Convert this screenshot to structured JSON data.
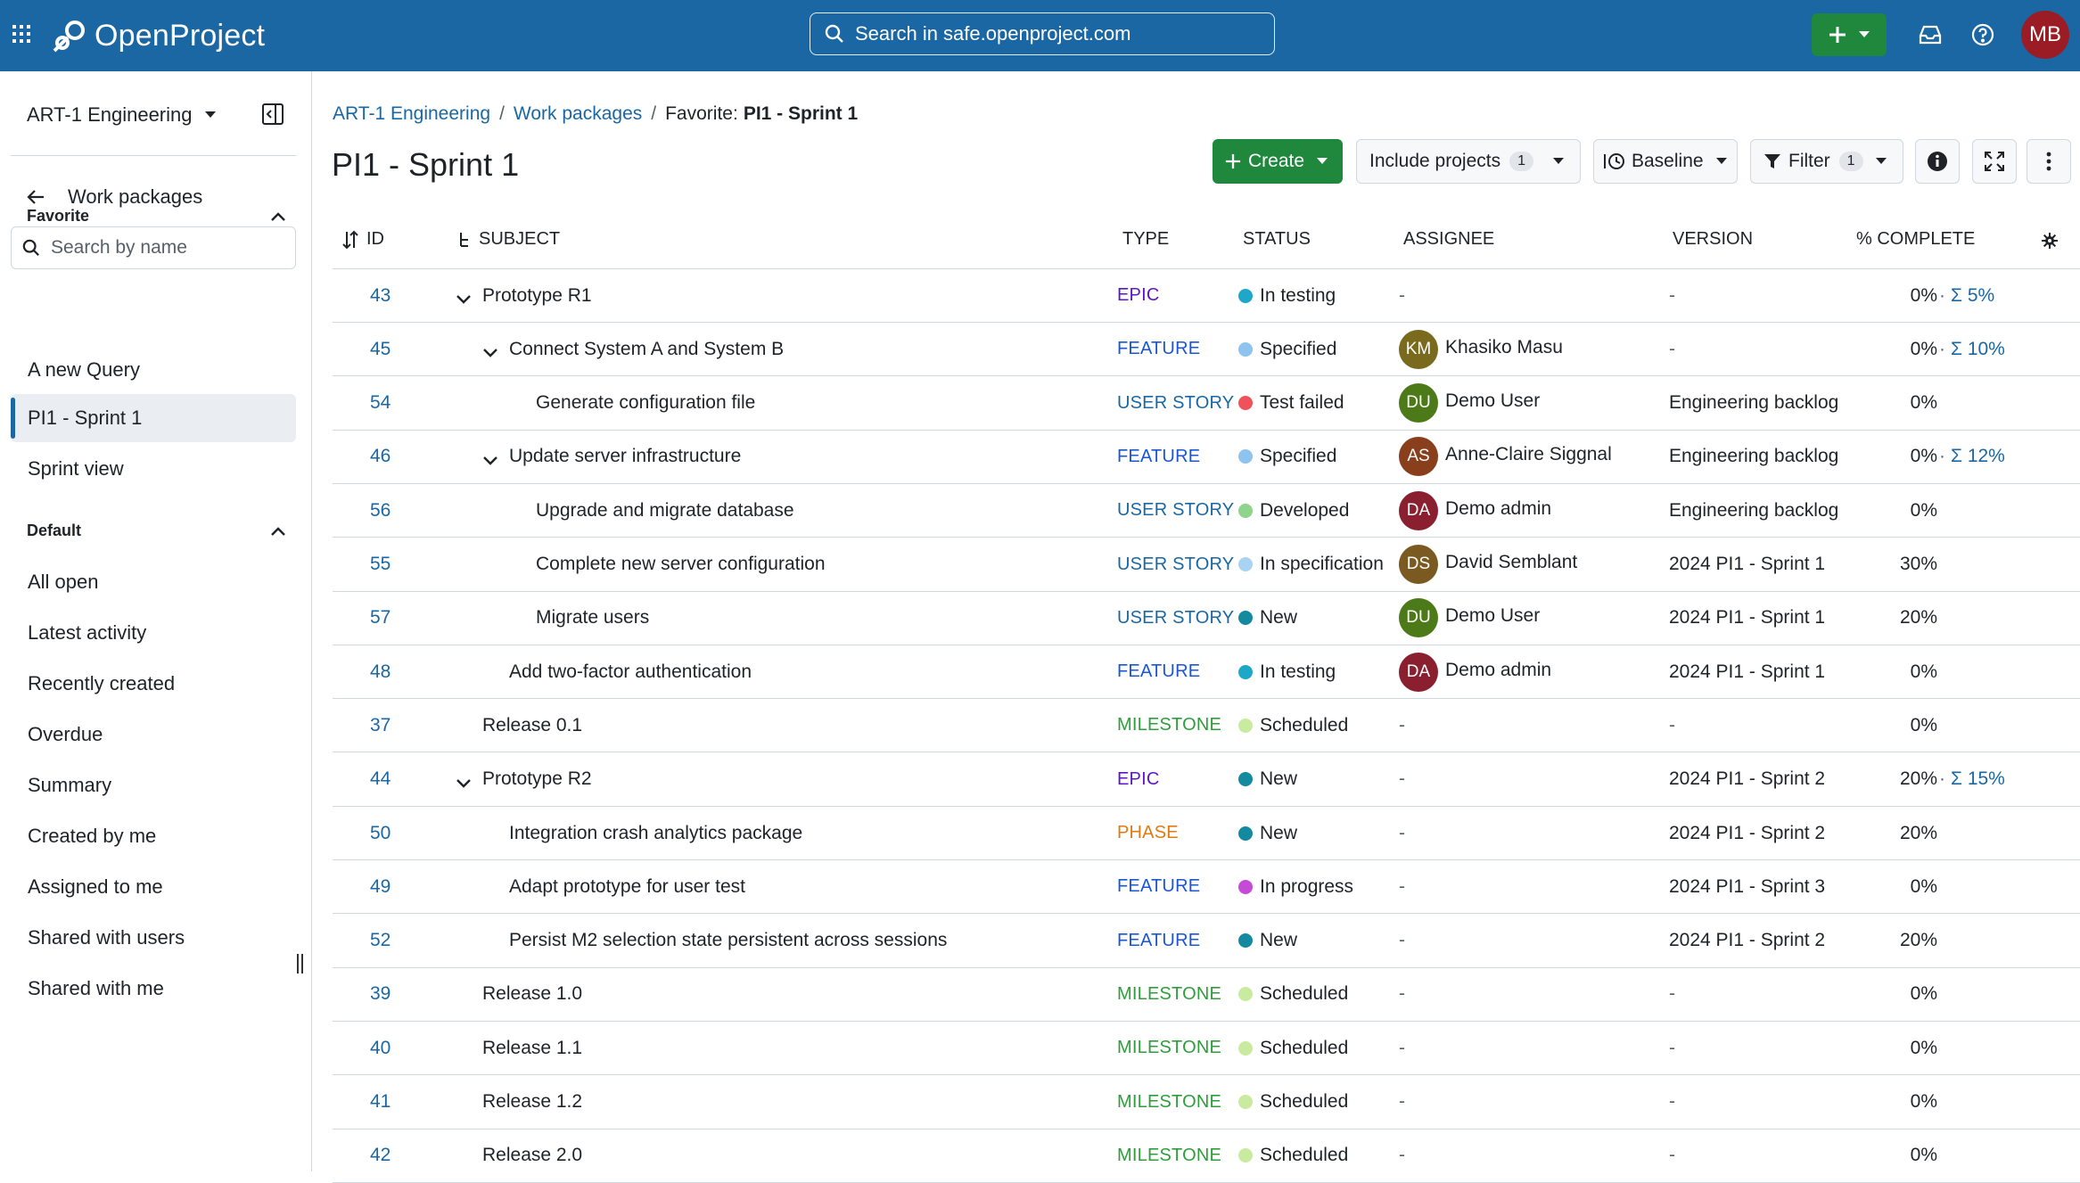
{
  "header": {
    "logo_text": "OpenProject",
    "search_placeholder": "Search in safe.openproject.com",
    "avatar_initials": "MB"
  },
  "sidebar": {
    "project": "ART-1 Engineering",
    "back_label": "Work packages",
    "search_placeholder": "Search by name",
    "favorite_title": "Favorite",
    "favorite_items": [
      "A new Query",
      "PI1 - Sprint 1",
      "Sprint view"
    ],
    "default_title": "Default",
    "default_items": [
      "All open",
      "Latest activity",
      "Recently created",
      "Overdue",
      "Summary",
      "Created by me",
      "Assigned to me",
      "Shared with users",
      "Shared with me"
    ]
  },
  "breadcrumb": {
    "project": "ART-1 Engineering",
    "work_packages": "Work packages",
    "current_prefix": "Favorite:",
    "current_name": "PI1 - Sprint 1"
  },
  "title": "PI1 - Sprint 1",
  "toolbar": {
    "create": "Create",
    "include_projects": "Include projects",
    "include_projects_count": "1",
    "baseline": "Baseline",
    "filter": "Filter",
    "filter_count": "1"
  },
  "columns": {
    "id": "ID",
    "subject": "SUBJECT",
    "type": "TYPE",
    "status": "STATUS",
    "assignee": "ASSIGNEE",
    "version": "VERSION",
    "complete": "% COMPLETE"
  },
  "colors": {
    "brand": "#1a67a3",
    "create_green": "#1f883d",
    "epic": "#5b16c8",
    "feature": "#1a56d6",
    "user_story": "#1a67a3",
    "milestone": "#2e9e3a",
    "phase": "#e07b12"
  },
  "rows": [
    {
      "id": "43",
      "level": 0,
      "expand": true,
      "subject": "Prototype R1",
      "type": "EPIC",
      "type_color": "#5b16c8",
      "status": "In testing",
      "status_color": "#1fa7c9",
      "assignee": "-",
      "initials": "",
      "avatar_color": "",
      "version": "-",
      "pct": "0%",
      "sum": "Σ 5%"
    },
    {
      "id": "45",
      "level": 1,
      "expand": true,
      "subject": "Connect System A and System B",
      "type": "FEATURE",
      "type_color": "#1a56d6",
      "status": "Specified",
      "status_color": "#8cc3ef",
      "assignee": "Khasiko Masu",
      "initials": "KM",
      "avatar_color": "#7a6a1e",
      "version": "-",
      "pct": "0%",
      "sum": "Σ 10%"
    },
    {
      "id": "54",
      "level": 2,
      "expand": false,
      "subject": "Generate configuration file",
      "type": "USER STORY",
      "type_color": "#1a67a3",
      "status": "Test failed",
      "status_color": "#f0525a",
      "assignee": "Demo User",
      "initials": "DU",
      "avatar_color": "#4d7a18",
      "version": "Engineering backlog",
      "pct": "0%",
      "sum": ""
    },
    {
      "id": "46",
      "level": 1,
      "expand": true,
      "subject": "Update server infrastructure",
      "type": "FEATURE",
      "type_color": "#1a56d6",
      "status": "Specified",
      "status_color": "#8cc3ef",
      "assignee": "Anne-Claire Siggnal",
      "initials": "AS",
      "avatar_color": "#8a3f1c",
      "version": "Engineering backlog",
      "pct": "0%",
      "sum": "Σ 12%"
    },
    {
      "id": "56",
      "level": 2,
      "expand": false,
      "subject": "Upgrade and migrate database",
      "type": "USER STORY",
      "type_color": "#1a67a3",
      "status": "Developed",
      "status_color": "#8ed48c",
      "assignee": "Demo admin",
      "initials": "DA",
      "avatar_color": "#8a1f30",
      "version": "Engineering backlog",
      "pct": "0%",
      "sum": ""
    },
    {
      "id": "55",
      "level": 2,
      "expand": false,
      "subject": "Complete new server configuration",
      "type": "USER STORY",
      "type_color": "#1a67a3",
      "status": "In specification",
      "status_color": "#a8d3f2",
      "assignee": "David Semblant",
      "initials": "DS",
      "avatar_color": "#7a5a20",
      "version": "2024 PI1 - Sprint 1",
      "pct": "30%",
      "sum": ""
    },
    {
      "id": "57",
      "level": 2,
      "expand": false,
      "subject": "Migrate users",
      "type": "USER STORY",
      "type_color": "#1a67a3",
      "status": "New",
      "status_color": "#148aa0",
      "assignee": "Demo User",
      "initials": "DU",
      "avatar_color": "#4d7a18",
      "version": "2024 PI1 - Sprint 1",
      "pct": "20%",
      "sum": ""
    },
    {
      "id": "48",
      "level": 1,
      "expand": false,
      "subject": "Add two-factor authentication",
      "type": "FEATURE",
      "type_color": "#1a56d6",
      "status": "In testing",
      "status_color": "#1fa7c9",
      "assignee": "Demo admin",
      "initials": "DA",
      "avatar_color": "#8a1f30",
      "version": "2024 PI1 - Sprint 1",
      "pct": "0%",
      "sum": ""
    },
    {
      "id": "37",
      "level": 0,
      "expand": false,
      "subject": "Release 0.1",
      "type": "MILESTONE",
      "type_color": "#2e9e3a",
      "status": "Scheduled",
      "status_color": "#c9eba0",
      "assignee": "-",
      "initials": "",
      "avatar_color": "",
      "version": "-",
      "pct": "0%",
      "sum": ""
    },
    {
      "id": "44",
      "level": 0,
      "expand": true,
      "subject": "Prototype R2",
      "type": "EPIC",
      "type_color": "#5b16c8",
      "status": "New",
      "status_color": "#148aa0",
      "assignee": "-",
      "initials": "",
      "avatar_color": "",
      "version": "2024 PI1 - Sprint 2",
      "pct": "20%",
      "sum": "Σ 15%"
    },
    {
      "id": "50",
      "level": 1,
      "expand": false,
      "subject": "Integration crash analytics package",
      "type": "PHASE",
      "type_color": "#e07b12",
      "status": "New",
      "status_color": "#148aa0",
      "assignee": "-",
      "initials": "",
      "avatar_color": "",
      "version": "2024 PI1 - Sprint 2",
      "pct": "20%",
      "sum": ""
    },
    {
      "id": "49",
      "level": 1,
      "expand": false,
      "subject": "Adapt prototype for user test",
      "type": "FEATURE",
      "type_color": "#1a56d6",
      "status": "In progress",
      "status_color": "#c64ad8",
      "assignee": "-",
      "initials": "",
      "avatar_color": "",
      "version": "2024 PI1 - Sprint 3",
      "pct": "0%",
      "sum": ""
    },
    {
      "id": "52",
      "level": 1,
      "expand": false,
      "subject": "Persist M2 selection state persistent across sessions",
      "type": "FEATURE",
      "type_color": "#1a56d6",
      "status": "New",
      "status_color": "#148aa0",
      "assignee": "-",
      "initials": "",
      "avatar_color": "",
      "version": "2024 PI1 - Sprint 2",
      "pct": "20%",
      "sum": ""
    },
    {
      "id": "39",
      "level": 0,
      "expand": false,
      "subject": "Release 1.0",
      "type": "MILESTONE",
      "type_color": "#2e9e3a",
      "status": "Scheduled",
      "status_color": "#c9eba0",
      "assignee": "-",
      "initials": "",
      "avatar_color": "",
      "version": "-",
      "pct": "0%",
      "sum": ""
    },
    {
      "id": "40",
      "level": 0,
      "expand": false,
      "subject": "Release 1.1",
      "type": "MILESTONE",
      "type_color": "#2e9e3a",
      "status": "Scheduled",
      "status_color": "#c9eba0",
      "assignee": "-",
      "initials": "",
      "avatar_color": "",
      "version": "-",
      "pct": "0%",
      "sum": ""
    },
    {
      "id": "41",
      "level": 0,
      "expand": false,
      "subject": "Release 1.2",
      "type": "MILESTONE",
      "type_color": "#2e9e3a",
      "status": "Scheduled",
      "status_color": "#c9eba0",
      "assignee": "-",
      "initials": "",
      "avatar_color": "",
      "version": "-",
      "pct": "0%",
      "sum": ""
    },
    {
      "id": "42",
      "level": 0,
      "expand": false,
      "subject": "Release 2.0",
      "type": "MILESTONE",
      "type_color": "#2e9e3a",
      "status": "Scheduled",
      "status_color": "#c9eba0",
      "assignee": "-",
      "initials": "",
      "avatar_color": "",
      "version": "-",
      "pct": "0%",
      "sum": ""
    }
  ]
}
